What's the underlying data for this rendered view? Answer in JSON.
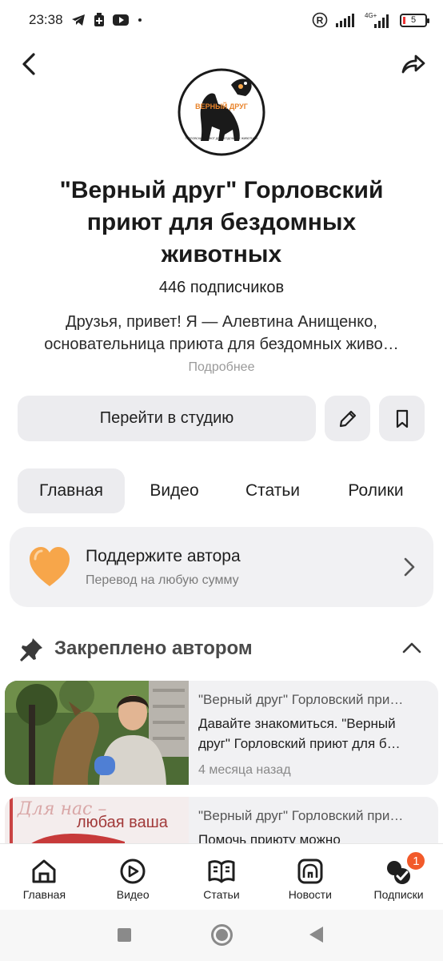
{
  "status_bar": {
    "time": "23:38",
    "network": "4G+",
    "battery": "5"
  },
  "channel": {
    "logo_text": "ВЕРНЫЙ ДРУГ",
    "logo_caption": "ГОРЛОВСКИЙ ПРИЮТ ДЛЯ БЕЗДОМНЫХ ЖИВОТНЫХ",
    "title": "\"Верный друг\" Горловский приют для бездомных животных",
    "subscribers": "446 подписчиков",
    "description_line1": "Друзья, привет! Я — Алевтина Анищенко,",
    "description_line2": "основательница приюта для бездомных живо…",
    "more": "Подробнее"
  },
  "actions": {
    "studio_label": "Перейти в студию"
  },
  "tabs": [
    {
      "label": "Главная",
      "active": true
    },
    {
      "label": "Видео",
      "active": false
    },
    {
      "label": "Статьи",
      "active": false
    },
    {
      "label": "Ролики",
      "active": false
    }
  ],
  "donate": {
    "title": "Поддержите автора",
    "subtitle": "Перевод на любую сумму"
  },
  "pinned": {
    "title": "Закреплено автором",
    "items": [
      {
        "channel": "\"Верный друг\" Горловский при…",
        "title": "Давайте знакомиться. \"Верный друг\" Горловский приют для б…",
        "time": "4 месяца назад"
      },
      {
        "channel": "\"Верный друг\" Горловский при…",
        "title": "Помочь приюту можно",
        "thumb_text1": "Для нас –",
        "thumb_text2": "любая ваша"
      }
    ]
  },
  "bottom_nav": [
    {
      "label": "Главная",
      "icon": "home-icon"
    },
    {
      "label": "Видео",
      "icon": "video-icon"
    },
    {
      "label": "Статьи",
      "icon": "articles-icon"
    },
    {
      "label": "Новости",
      "icon": "news-icon"
    },
    {
      "label": "Подписки",
      "icon": "subscriptions-icon",
      "badge": "1"
    }
  ],
  "colors": {
    "accent_badge": "#f25a2a",
    "heart": "#f7a64a",
    "surface": "#ececef"
  }
}
